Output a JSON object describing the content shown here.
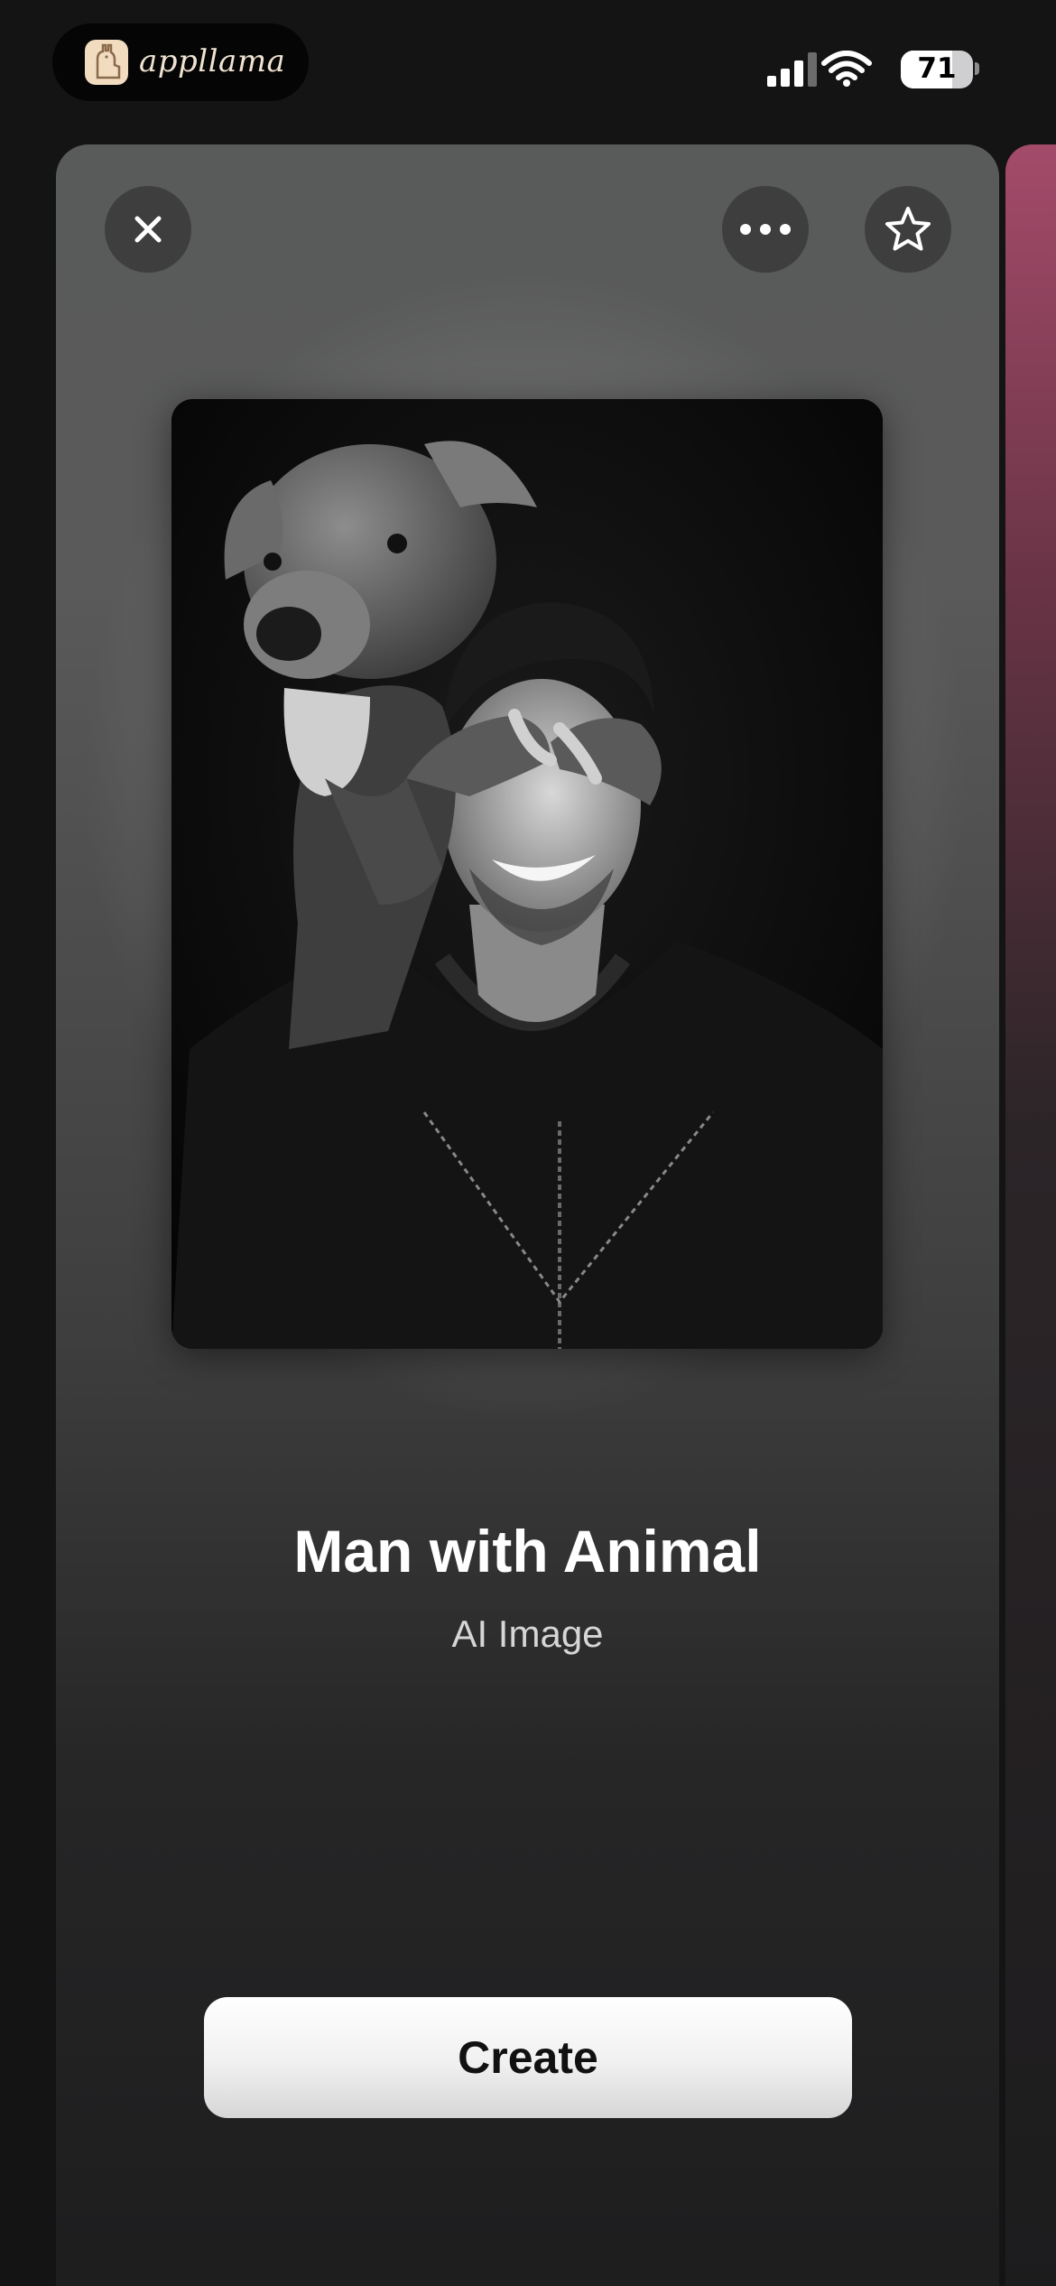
{
  "status_bar": {
    "app_name": "appllama",
    "battery_level": "71",
    "signal_icon": "cellular-signal-icon",
    "wifi_icon": "wifi-icon"
  },
  "card": {
    "title": "Man with Animal",
    "subtitle": "AI Image",
    "create_label": "Create",
    "close_icon": "close-icon",
    "more_icon": "more-horizontal-icon",
    "favorite_icon": "star-icon",
    "image_description_icon": "generated-image"
  },
  "colors": {
    "background": "#141415",
    "button_light": "#f0f0f0",
    "next_card_accent": "#a44b6a",
    "logo_bg": "#f2dcc0"
  }
}
